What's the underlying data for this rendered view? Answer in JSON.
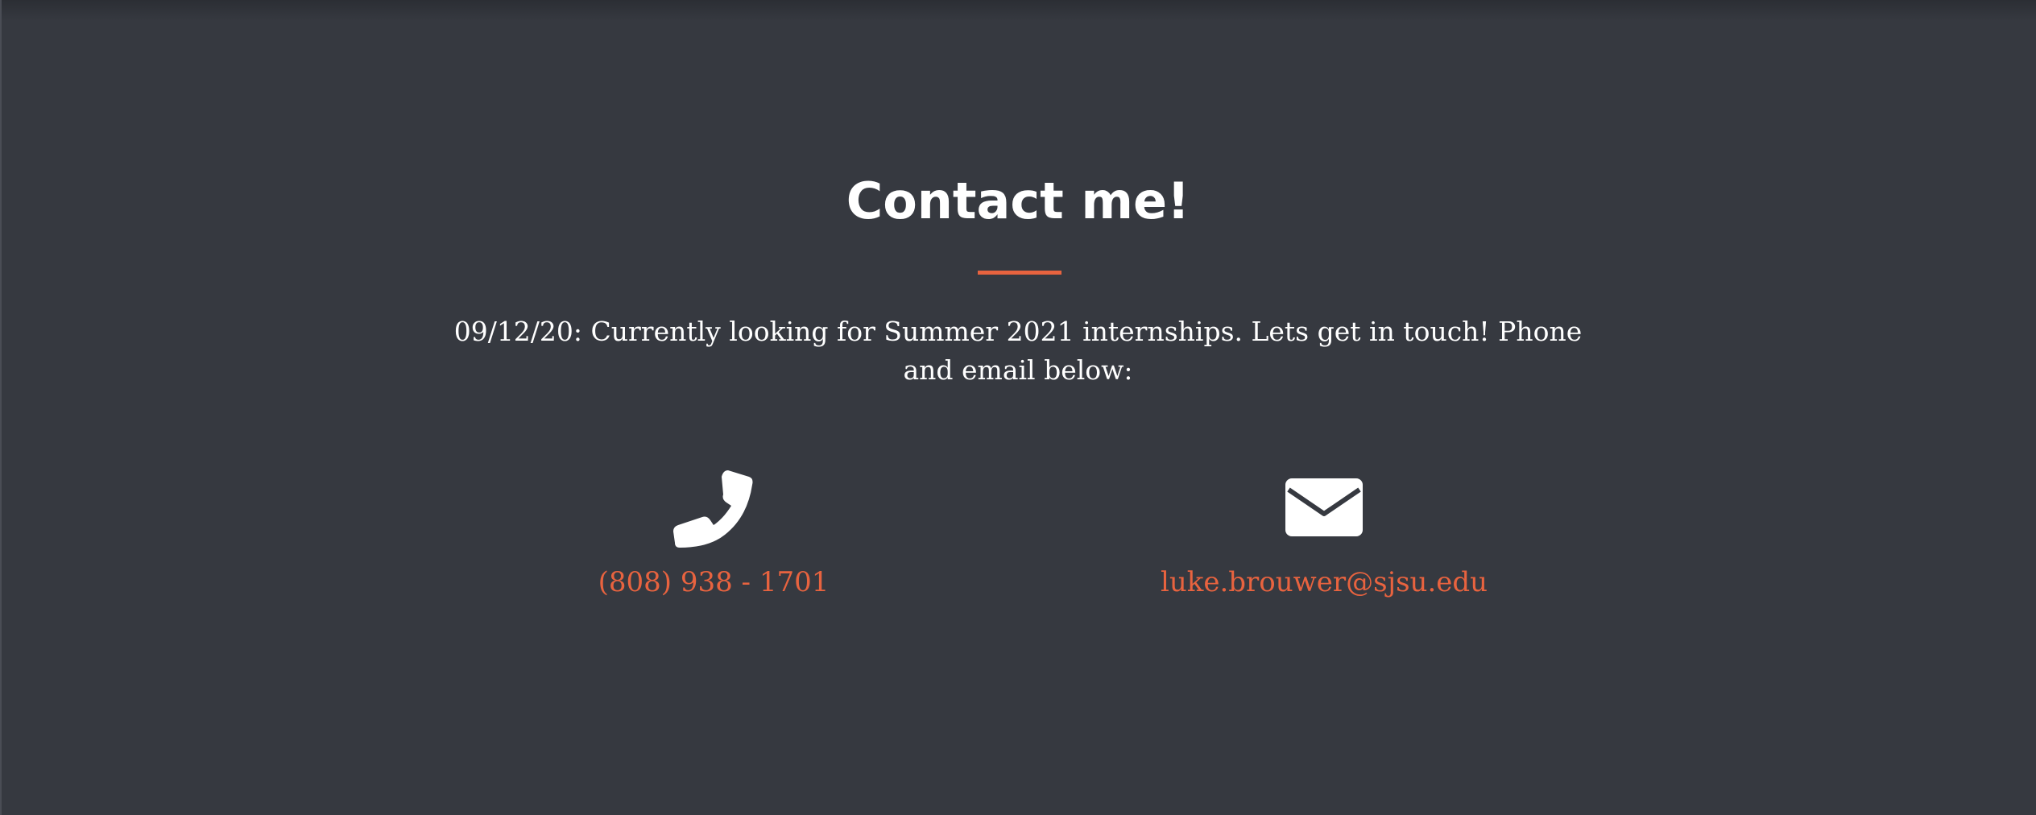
{
  "contact": {
    "title": "Contact me!",
    "message": "09/12/20: Currently looking for Summer 2021 internships. Lets get in touch! Phone and email below:",
    "phone": {
      "icon": "phone-icon",
      "text": "(808) 938 - 1701"
    },
    "email": {
      "icon": "envelope-icon",
      "text": "luke.brouwer@sjsu.edu"
    }
  },
  "colors": {
    "background": "#363940",
    "accent": "#e8633f",
    "text": "#ffffff"
  }
}
